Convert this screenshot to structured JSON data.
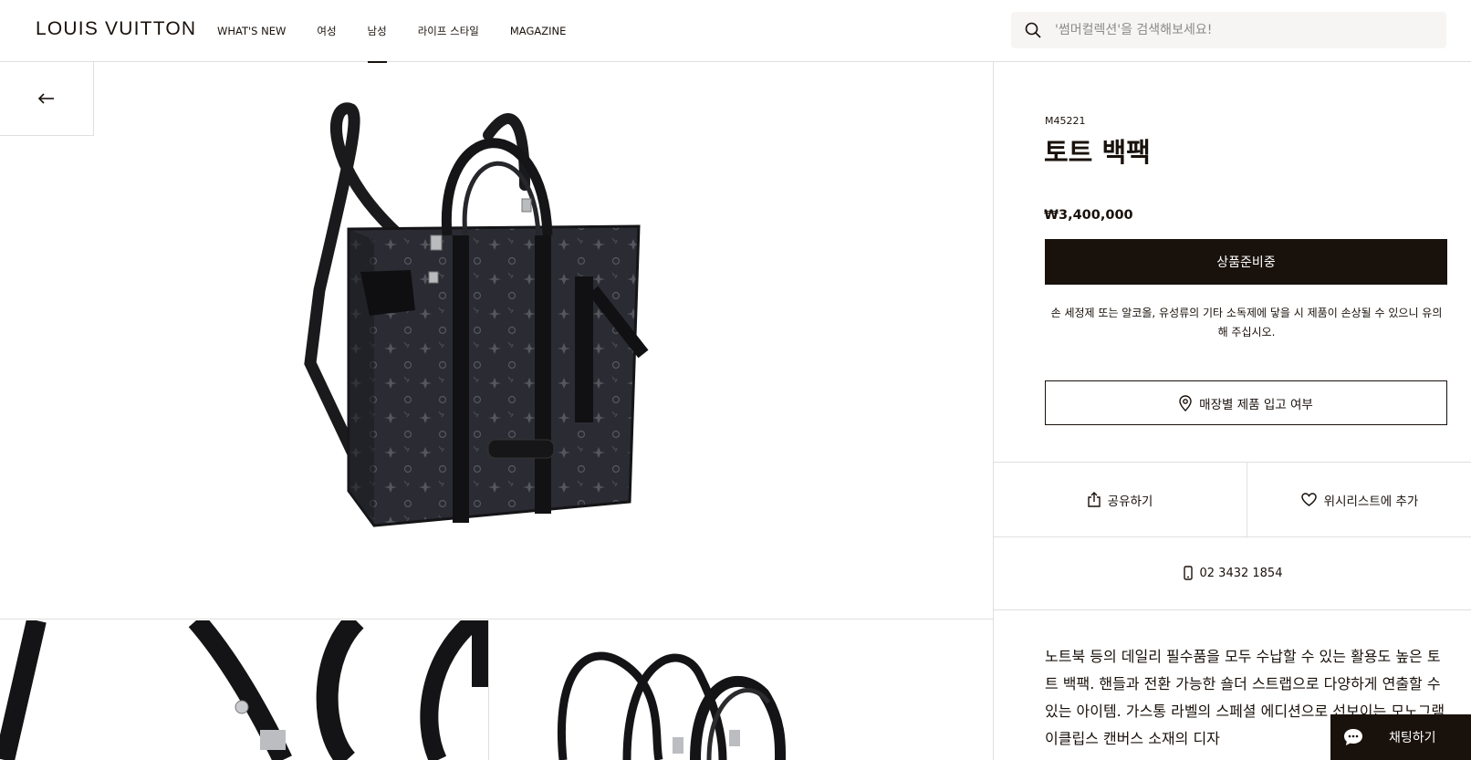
{
  "header": {
    "logo": "LOUIS VUITTON",
    "nav": [
      {
        "label": "WHAT'S NEW"
      },
      {
        "label": "여성"
      },
      {
        "label": "남성"
      },
      {
        "label": "라이프 스타일"
      },
      {
        "label": "MAGAZINE"
      }
    ],
    "active_nav": "남성",
    "search_placeholder": "'썸머컬렉션'을 검색해보세요!"
  },
  "product": {
    "sku": "M45221",
    "name": "토트 백팩",
    "price": "₩3,400,000",
    "primary_button": "상품준비중",
    "notice": "손 세정제 또는 알코올, 유성류의 기타 소독제에 닿을 시 제품이 손상될 수 있으니 유의해 주십시오.",
    "store_button": "매장별 제품 입고 여부",
    "share_label": "공유하기",
    "wishlist_label": "위시리스트에 추가",
    "phone": "02 3432 1854",
    "description": "노트북 등의 데일리 필수품을 모두 수납할 수 있는 활용도 높은 토트 백팩. 핸들과 전환 가능한 숄더 스트랩으로 다양하게 연출할 수 있는 아이템. 가스통 라벨의 스페셜 에디션으로 선보이는 모노그램 이클립스 캔버스 소재의 디자"
  },
  "chat": {
    "label": "채팅하기"
  },
  "colors": {
    "brand_dark": "#19110b",
    "border": "#e1dfdd",
    "search_bg": "#f6f5f3"
  },
  "icons": [
    "search-icon",
    "back-arrow-icon",
    "location-pin-icon",
    "share-icon",
    "heart-icon",
    "phone-icon",
    "chat-icon"
  ]
}
